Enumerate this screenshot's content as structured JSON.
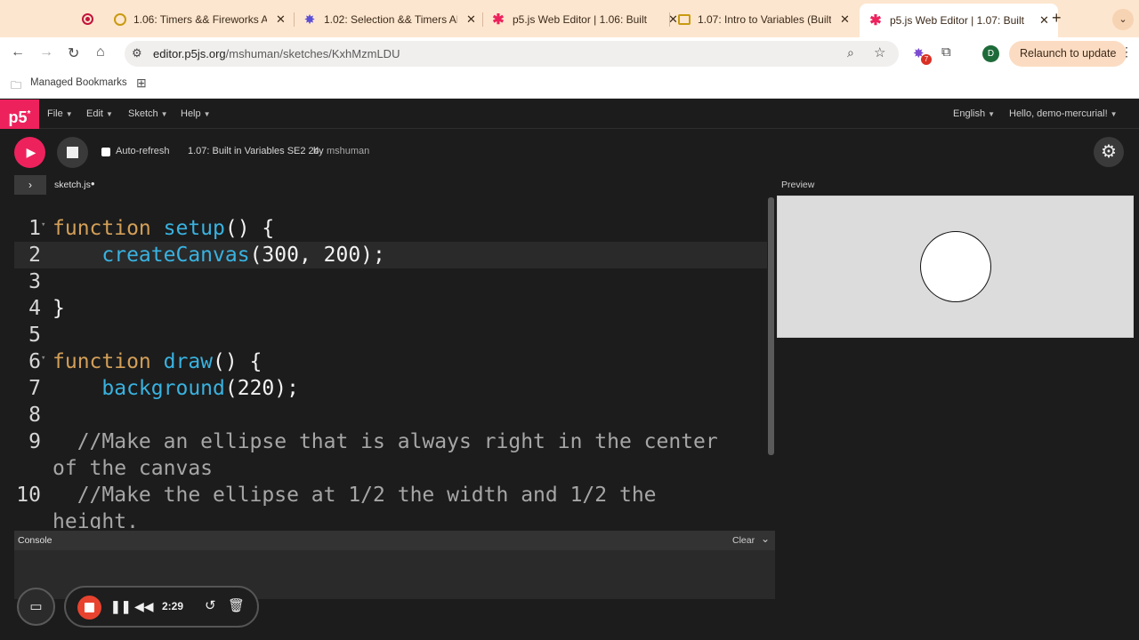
{
  "browser": {
    "tabs": [
      {
        "title": "1.06: Timers && Fireworks AP",
        "icon": "slides-icon",
        "active": false
      },
      {
        "title": "1.02: Selection && Timers AP",
        "icon": "gear-logo-icon",
        "active": false
      },
      {
        "title": "p5.js Web Editor | 1.06: Built",
        "icon": "p5-asterisk-icon",
        "active": false
      },
      {
        "title": "1.07: Intro to Variables (Built",
        "icon": "slides-icon",
        "active": false
      },
      {
        "title": "p5.js Web Editor | 1.07: Built",
        "icon": "p5-asterisk-icon",
        "active": true
      }
    ],
    "address": {
      "host": "editor.p5js.org",
      "path": "/mshuman/sketches/KxhMzmLDU"
    },
    "extension_badge": "7",
    "profile_initial": "D",
    "relaunch_label": "Relaunch to update",
    "bookmarks_label": "Managed Bookmarks"
  },
  "p5": {
    "logo": "p5",
    "menus": [
      {
        "label": "File"
      },
      {
        "label": "Edit"
      },
      {
        "label": "Sketch"
      },
      {
        "label": "Help"
      }
    ],
    "language": "English",
    "greeting": "Hello, demo-mercurial!",
    "autorefresh_label": "Auto-refresh",
    "sketch_name": "1.07: Built in Variables SE2 24",
    "by_label": "by",
    "owner": "mshuman",
    "file_tab": "sketch.js",
    "preview_label": "Preview",
    "console_label": "Console",
    "clear_label": "Clear"
  },
  "code": [
    {
      "n": "1",
      "fold": true,
      "tokens": [
        {
          "t": "kw",
          "v": "function "
        },
        {
          "t": "fn",
          "v": "setup"
        },
        {
          "t": "p",
          "v": "() {"
        }
      ]
    },
    {
      "n": "2",
      "fold": false,
      "tokens": [
        {
          "t": "p",
          "v": "    "
        },
        {
          "t": "fn",
          "v": "createCanvas"
        },
        {
          "t": "p",
          "v": "(300, 200);"
        }
      ]
    },
    {
      "n": "3",
      "fold": false,
      "tokens": []
    },
    {
      "n": "4",
      "fold": false,
      "tokens": [
        {
          "t": "p",
          "v": "}"
        }
      ]
    },
    {
      "n": "5",
      "fold": false,
      "tokens": []
    },
    {
      "n": "6",
      "fold": true,
      "tokens": [
        {
          "t": "kw",
          "v": "function "
        },
        {
          "t": "fn",
          "v": "draw"
        },
        {
          "t": "p",
          "v": "() {"
        }
      ]
    },
    {
      "n": "7",
      "fold": false,
      "tokens": [
        {
          "t": "p",
          "v": "    "
        },
        {
          "t": "fn",
          "v": "background"
        },
        {
          "t": "p",
          "v": "(220);"
        }
      ]
    },
    {
      "n": "8",
      "fold": false,
      "tokens": []
    },
    {
      "n": "9",
      "fold": false,
      "tokens": [
        {
          "t": "cm",
          "v": "  //Make an ellipse that is always right in the center"
        }
      ]
    },
    {
      "n": "",
      "fold": false,
      "tokens": [
        {
          "t": "cm",
          "v": "of the canvas"
        }
      ]
    },
    {
      "n": "10",
      "fold": false,
      "tokens": [
        {
          "t": "cm",
          "v": "  //Make the ellipse at 1/2 the width and 1/2 the"
        }
      ]
    },
    {
      "n": "",
      "fold": false,
      "tokens": [
        {
          "t": "cm",
          "v": "height."
        }
      ]
    }
  ],
  "recorder": {
    "time": "2:29"
  }
}
